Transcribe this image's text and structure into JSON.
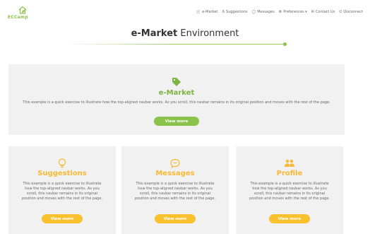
{
  "brand": {
    "logo_text": "ECCamp"
  },
  "nav": {
    "items": [
      {
        "label": "e-Market",
        "icon": "cart-icon"
      },
      {
        "label": "Suggestions",
        "icon": "lightbulb-icon"
      },
      {
        "label": "Messages",
        "icon": "chat-icon"
      },
      {
        "label": "Preferences ▾",
        "icon": "gears-icon"
      },
      {
        "label": "Contact Us",
        "icon": "envelope-icon"
      },
      {
        "label": "Disconnect",
        "icon": "power-icon"
      }
    ]
  },
  "page": {
    "title_bold": "e-Market",
    "title_rest": " Environment"
  },
  "hero": {
    "icon": "tags-icon",
    "title": "e-Market",
    "description": "This example is a quick exercise to illustrate how the top-aligned navbar works. As you scroll, this navbar remains in its original position and moves with the rest of the page.",
    "button": "View more"
  },
  "cards": [
    {
      "icon": "lightbulb-icon",
      "title": "Suggestions",
      "description": "This example is a quick exercise to illustrate how the top-aligned navbar works. As you scroll, this navbar remains in its original position and moves with the rest of the page.",
      "button": "View more"
    },
    {
      "icon": "chat-icon",
      "title": "Messages",
      "description": "This example is a quick exercise to illustrate how the top-aligned navbar works. As you scroll, this navbar remains in its original position and moves with the rest of the page.",
      "button": "View more"
    },
    {
      "icon": "users-icon",
      "title": "Profile",
      "description": "This example is a quick exercise to illustrate how the top-aligned navbar works. As you scroll, this navbar remains in its original position and moves with the rest of the page.",
      "button": "View more"
    }
  ],
  "colors": {
    "green": "#8bc34a",
    "yellow": "#f9c12e",
    "panel": "#f1f1f1"
  }
}
